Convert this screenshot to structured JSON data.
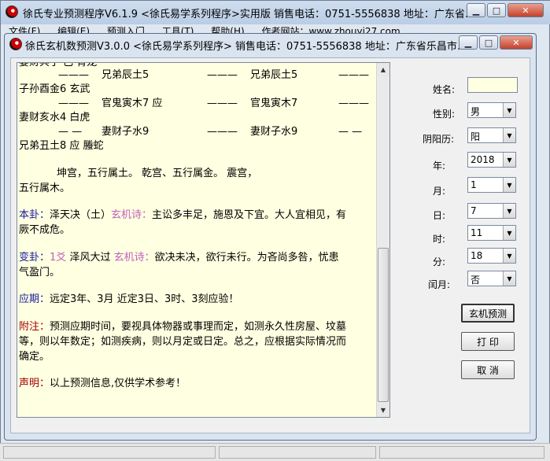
{
  "bg_window": {
    "title": "徐氏专业预测程序V6.1.9  <徐氏易学系列程序>实用版   销售电话：0751-5556838   地址：广东省…",
    "menu": [
      "文件(F)",
      "编辑(E)",
      "预测入门",
      "工具(T)",
      "帮助(H)",
      "作者网站：www.zhouyi27.com"
    ]
  },
  "window": {
    "title": "徐氏玄机数预测V3.0.0   <徐氏易学系列程序>   销售电话：0751-5556838   地址：广东省乐昌市…"
  },
  "content": {
    "row0": "妻财兵子 已   青龙",
    "row1_dash1": "———",
    "row1_a": "兄弟辰土5",
    "row1_dash2": "———",
    "row1_b": "兄弟辰土5",
    "row1_dash3": "———",
    "row2": "子孙酉金6         玄武",
    "row3_dash1": "———",
    "row3_a": "官鬼寅木7 应",
    "row3_dash2": "———",
    "row3_b": "官鬼寅木7",
    "row3_dash3": "———",
    "row4": "妻财亥水4         白虎",
    "row5_dash1": "— —",
    "row5_a": "妻财子水9",
    "row5_dash2": "———",
    "row5_b": "妻财子水9",
    "row5_dash3": "— —",
    "row6": "兄弟丑土8 应      螣蛇",
    "palace_line": "坤宫，五行属土。           乾宫、五行属金。          震宫，",
    "palace_line2": "五行属木。",
    "bengua_label": "本卦：",
    "bengua_text": "泽天决（土）",
    "bengua_poem_label": "玄机诗：",
    "bengua_poem": "主讼多丰足，施恩及下宜。大人宜相见，有",
    "bengua_poem2": "厥不成危。",
    "biangua_label": "变卦：",
    "biangua_num": "1爻",
    "biangua_text": "泽风大过 ",
    "biangua_poem_label": "玄机诗：",
    "biangua_poem": "欲决未决，欲行未行。为吝尚多咎，忧患",
    "biangua_poem2": "气盈门。",
    "yingqi_label": "应期：",
    "yingqi_text": "远定3年、3月  近定3日、3时、3刻应验！",
    "fuzhu_label": "附注：",
    "fuzhu_l1": "预测应期时间，要视具体物器或事理而定，如测永久性房屋、坟墓",
    "fuzhu_l2": "等，则以年数定；如测疾病，则以月定或日定。总之，应根据实际情况而",
    "fuzhu_l3": "确定。",
    "shengming_label": "声明：",
    "shengming_text": "以上预测信息,仅供学术参考！"
  },
  "form": {
    "name_label": "姓名:",
    "name_value": "",
    "gender_label": "性别:",
    "gender_value": "男",
    "calendar_label": "阴阳历:",
    "calendar_value": "阳",
    "year_label": "年:",
    "year_value": "2018",
    "month_label": "月:",
    "month_value": "1",
    "day_label": "日:",
    "day_value": "7",
    "hour_label": "时:",
    "hour_value": "11",
    "minute_label": "分:",
    "minute_value": "18",
    "leap_label": "闰月:",
    "leap_value": "否"
  },
  "buttons": {
    "predict": "玄机预测",
    "print": "打 印",
    "cancel": "取 消"
  },
  "colors": {
    "text_bg": "#ffffe1",
    "label_blue": "#1a1aa0",
    "label_red": "#a00000",
    "accent_magenta": "#c060c0"
  }
}
